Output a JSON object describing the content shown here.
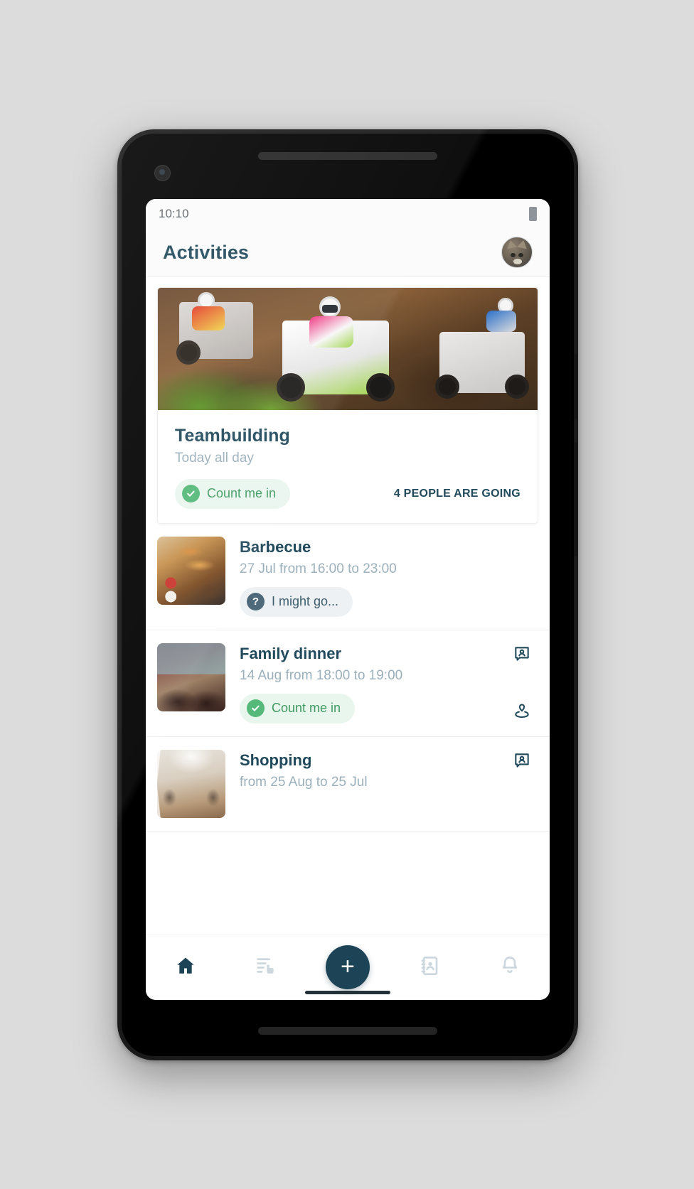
{
  "status_bar": {
    "time": "10:10",
    "battery_icon": "battery-icon"
  },
  "app_bar": {
    "title": "Activities",
    "avatar_name": "user-avatar"
  },
  "hero": {
    "image_alt": "quad-bike-race-photo",
    "title": "Teambuilding",
    "subtitle": "Today all day",
    "chip": {
      "label": "Count me in",
      "state": "yes",
      "icon": "check-circle-icon"
    },
    "going_label": "4 PEOPLE ARE GOING"
  },
  "activities": [
    {
      "thumb": "barbecue-photo",
      "title": "Barbecue",
      "subtitle": "27 Jul from 16:00 to 23:00",
      "chip": {
        "label": "I might go...",
        "state": "maybe",
        "icon": "question-circle-icon"
      },
      "actions": []
    },
    {
      "thumb": "family-dinner-photo",
      "title": "Family dinner",
      "subtitle": "14 Aug from 18:00 to 19:00",
      "chip": {
        "label": "Count me in",
        "state": "yes",
        "icon": "check-circle-icon"
      },
      "actions": [
        "contact-card-icon",
        "location-pin-icon"
      ]
    },
    {
      "thumb": "shopping-gallery-photo",
      "title": "Shopping",
      "subtitle": "from 25 Aug to 25 Jul",
      "chip": null,
      "actions": [
        "contact-card-icon"
      ]
    }
  ],
  "bottom_nav": {
    "items": [
      {
        "icon": "home-icon",
        "active": true
      },
      {
        "icon": "poll-vote-icon",
        "active": false
      },
      {
        "icon": "plus-icon",
        "active": false,
        "fab": true,
        "label": "+"
      },
      {
        "icon": "address-book-icon",
        "active": false
      },
      {
        "icon": "bell-icon",
        "active": false
      }
    ]
  },
  "colors": {
    "primary": "#214a5c",
    "fab": "#1d4356",
    "muted": "#9bb0bb",
    "chip_yes_bg": "#e9f6ee",
    "chip_yes_fg": "#3f9a62",
    "chip_maybe_bg": "#eef1f3",
    "chip_maybe_fg": "#3e5d6c",
    "page_bg": "#dcdcdc"
  }
}
